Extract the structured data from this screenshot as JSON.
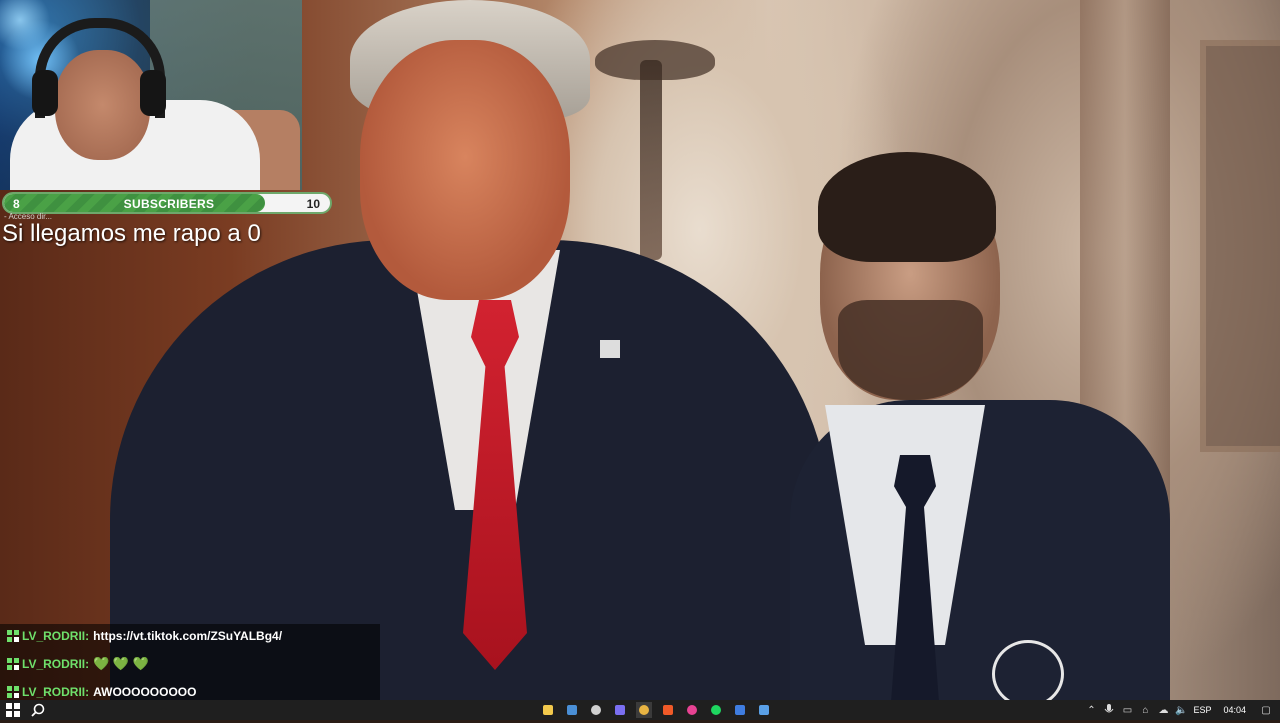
{
  "webcam": {
    "label": "streamer-webcam"
  },
  "subscribers": {
    "current": 8,
    "goal": 10,
    "label": "SUBSCRIBERS",
    "fill_fraction": 0.8
  },
  "overlay": {
    "access_text": "- Acceso dir...",
    "goal_text": "Si llegamos me rapo a 0"
  },
  "chat": {
    "messages": [
      {
        "user": "LV_RODRII:",
        "text": "https://vt.tiktok.com/ZSuYALBg4/"
      },
      {
        "user": "LV_RODRII:",
        "text": "💚 💚 💚"
      },
      {
        "user": "LV_RODRII:",
        "text": "AWOOOOOOOOO"
      }
    ]
  },
  "taskbar": {
    "apps": [
      {
        "name": "file-explorer-icon",
        "color": "#f2c94c"
      },
      {
        "name": "steam-icon",
        "color": "#4a8fd6"
      },
      {
        "name": "obs-icon",
        "color": "#d0d0d0"
      },
      {
        "name": "discord-icon",
        "color": "#7b6ff0"
      },
      {
        "name": "chrome-icon",
        "color": "#e8b443"
      },
      {
        "name": "brave-icon",
        "color": "#f05a28"
      },
      {
        "name": "media-player-icon",
        "color": "#e84393"
      },
      {
        "name": "spotify-icon",
        "color": "#1ed760"
      },
      {
        "name": "vpn-icon",
        "color": "#3f7de0"
      },
      {
        "name": "steam-2-icon",
        "color": "#5aa0e6"
      }
    ],
    "language": "ESP",
    "time": "04:04"
  }
}
